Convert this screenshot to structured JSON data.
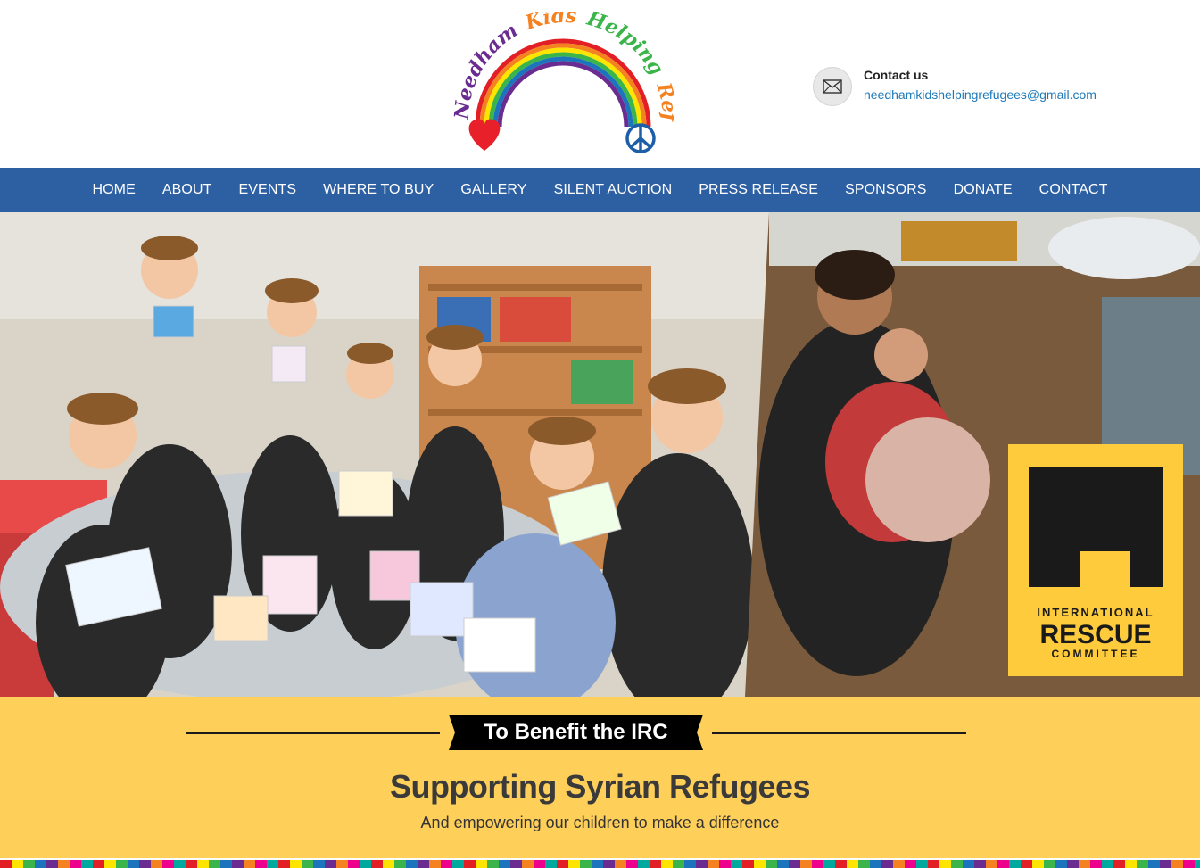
{
  "logo": {
    "line1": "Needham Kids Helping Refugees",
    "word_needham": "Needham",
    "word_kids": "Kids",
    "word_helping": "Helping",
    "word_refugees": "Refugees"
  },
  "contact": {
    "title": "Contact us",
    "email": "needhamkidshelpingrefugees@gmail.com",
    "icon": "envelope-icon"
  },
  "nav": {
    "items": [
      {
        "label": "HOME"
      },
      {
        "label": "ABOUT"
      },
      {
        "label": "EVENTS"
      },
      {
        "label": "WHERE TO BUY"
      },
      {
        "label": "GALLERY"
      },
      {
        "label": "SILENT AUCTION"
      },
      {
        "label": "PRESS RELEASE"
      },
      {
        "label": "SPONSORS"
      },
      {
        "label": "DONATE"
      },
      {
        "label": "CONTACT"
      }
    ]
  },
  "hero": {
    "irc_line1": "INTERNATIONAL",
    "irc_line2": "RESCUE",
    "irc_line3": "COMMITTEE"
  },
  "band": {
    "ribbon": "To Benefit the IRC",
    "title": "Supporting Syrian Refugees",
    "subtitle": "And empowering our children to make a difference"
  },
  "colors": {
    "nav_bg": "#2d5fa3",
    "band_bg": "#fecf59",
    "link": "#1d7ab8",
    "irc_yellow": "#fdcb3c"
  }
}
